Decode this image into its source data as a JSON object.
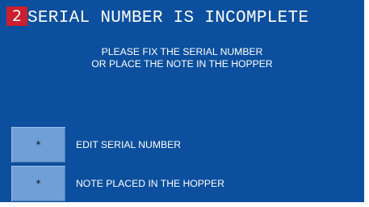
{
  "step_number": "2",
  "title": "SERIAL NUMBER IS INCOMPLETE",
  "message": {
    "line1": "PLEASE FIX THE SERIAL NUMBER",
    "line2": "OR PLACE THE NOTE IN THE HOPPER"
  },
  "options": [
    {
      "button": "*",
      "label": "EDIT SERIAL NUMBER"
    },
    {
      "button": "*",
      "label": "NOTE PLACED IN THE HOPPER"
    }
  ],
  "colors": {
    "panel": "#0b4f9e",
    "button": "#6f9fd6",
    "badge": "#cc1e2e",
    "text": "#ffffff"
  }
}
